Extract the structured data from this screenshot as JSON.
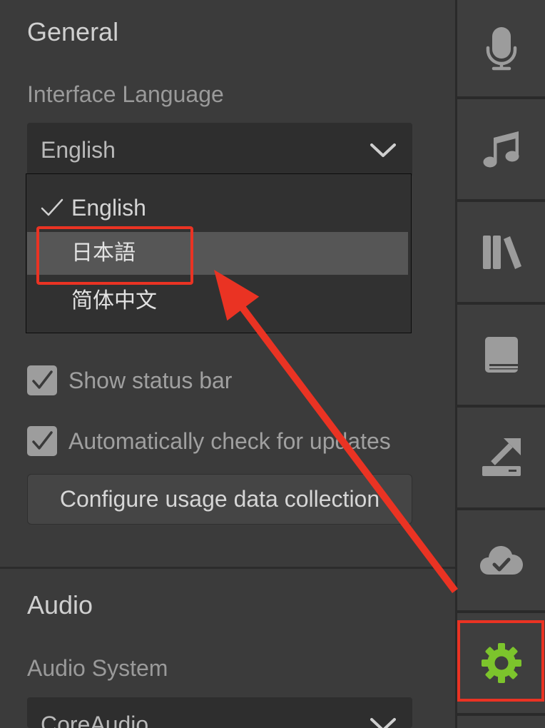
{
  "settings": {
    "general": {
      "heading": "General",
      "interface_language": {
        "label": "Interface Language",
        "selected": "English",
        "menu_open": true,
        "options": [
          {
            "label": "English",
            "checked": true,
            "highlighted": false
          },
          {
            "label": "日本語",
            "checked": false,
            "highlighted": true
          },
          {
            "label": "简体中文",
            "checked": false,
            "highlighted": false
          }
        ]
      },
      "checkboxes": [
        {
          "label": "Show status bar",
          "checked": true
        },
        {
          "label": "Automatically check for updates",
          "checked": true
        }
      ],
      "usage_data_button": "Configure usage data collection"
    },
    "audio": {
      "heading": "Audio",
      "audio_system": {
        "label": "Audio System",
        "selected": "CoreAudio"
      }
    }
  },
  "sidebar": {
    "items": [
      {
        "icon": "microphone-icon",
        "active": false
      },
      {
        "icon": "music-note-icon",
        "active": false
      },
      {
        "icon": "library-icon",
        "active": false
      },
      {
        "icon": "book-icon",
        "active": false
      },
      {
        "icon": "export-icon",
        "active": false
      },
      {
        "icon": "cloud-check-icon",
        "active": false
      },
      {
        "icon": "gear-icon",
        "active": true
      }
    ]
  },
  "colors": {
    "panel_bg": "#3b3b3b",
    "field_bg": "#2e2e2e",
    "popup_bg": "#313131",
    "highlight_bg": "#565656",
    "checkbox_bg": "#9d9d9d",
    "button_bg": "#454545",
    "separator": "#2a2a2a",
    "cell_bg": "#3e3e3e",
    "icon": "#9c9c9c",
    "accent": "#7cc42c",
    "annotation": "#ea3323"
  }
}
